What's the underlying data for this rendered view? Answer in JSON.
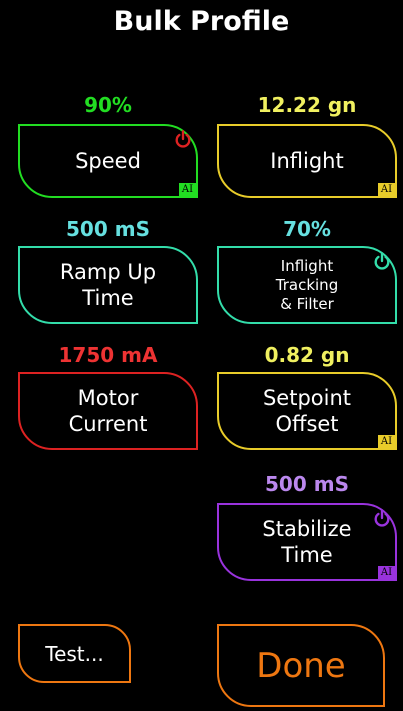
{
  "title": "Bulk Profile",
  "colors": {
    "green": "#22dd22",
    "yellow": "#e8cc2a",
    "cyan": "#33ddaa",
    "red": "#dd2222",
    "purple": "#9933dd",
    "orange": "#ee7711",
    "cyan_value": "#66e0e0",
    "yellow_value": "#f0f060",
    "red_value": "#ee3333",
    "purple_value": "#bb88ee"
  },
  "controls": {
    "speed": {
      "value": "90%",
      "label": "Speed",
      "badge": "AI",
      "icon": "power-icon"
    },
    "inflight": {
      "value": "12.22 gn",
      "label": "Inflight",
      "badge": "AI"
    },
    "ramp_up": {
      "value": "500 mS",
      "label_line1": "Ramp Up",
      "label_line2": "Time"
    },
    "inflight_tracking": {
      "value": "70%",
      "label_line1": "Inflight",
      "label_line2": "Tracking",
      "label_line3": "& Filter",
      "icon": "power-icon"
    },
    "motor_current": {
      "value": "1750 mA",
      "label_line1": "Motor",
      "label_line2": "Current"
    },
    "setpoint_offset": {
      "value": "0.82 gn",
      "label_line1": "Setpoint",
      "label_line2": "Offset",
      "badge": "AI"
    },
    "stabilize": {
      "value": "500 mS",
      "label_line1": "Stabilize",
      "label_line2": "Time",
      "badge": "AI",
      "icon": "power-icon"
    }
  },
  "actions": {
    "test_label": "Test...",
    "done_label": "Done"
  }
}
